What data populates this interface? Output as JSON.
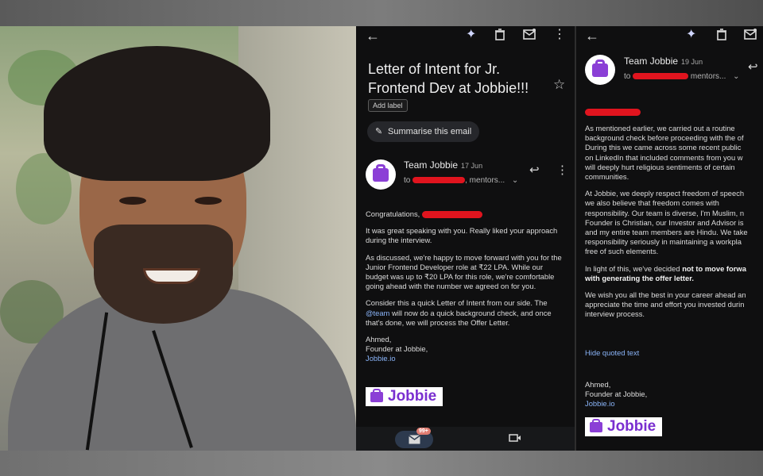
{
  "email1": {
    "subject": "Letter of Intent for Jr. Frontend Dev at Jobbie!!!",
    "label_chip": "Add label",
    "summarise_button": "Summarise this email",
    "sender": "Team Jobbie",
    "date": "17 Jun",
    "to_prefix": "to",
    "to_suffix": ", mentors...",
    "greeting": "Congratulations,",
    "paragraphs": [
      "It was great speaking with you. Really liked your approach during the interview.",
      "As discussed, we're happy to move forward with you for the Junior Frontend Developer role at ₹22 LPA. While our budget was up to ₹20 LPA for this role, we're comfortable going ahead with the number we agreed on for you."
    ],
    "para3_start": "Consider this a quick Letter of Intent from our side. The ",
    "para3_link": "@team",
    "para3_end": " will now do a quick background check, and once that's done, we will process the Offer Letter.",
    "signature_name": "Ahmed,",
    "signature_title": "Founder at Jobbie,",
    "signature_link": "Jobbie.io",
    "logo_text": "Jobbie",
    "unread_badge": "99+"
  },
  "email2": {
    "sender": "Team Jobbie",
    "date": "19 Jun",
    "to_prefix": "to",
    "to_suffix": "mentors...",
    "para1": [
      "As mentioned earlier, we carried out a routine",
      "background check before proceeding with the of",
      "During this we came across some recent public",
      "on LinkedIn that included comments from you w",
      "will deeply hurt religious sentiments of certain",
      "communities."
    ],
    "para2": [
      "At Jobbie, we deeply respect freedom of speech",
      "we also believe that freedom comes with",
      "responsibility. Our team is diverse, I'm Muslim, n",
      "Founder is Christian, our Investor and Advisor is",
      "and my entire team members are Hindu. We take",
      "responsibility seriously in maintaining a workpla",
      "free of such elements."
    ],
    "para3_start": "In light of this, we've decided ",
    "para3_bold_1": "not to move forwa",
    "para3_bold_2": "with generating the offer letter.",
    "para4": [
      "We wish you all the best in your career ahead an",
      "appreciate the time and effort you invested durin",
      "interview process."
    ],
    "hide_quoted": "Hide quoted text",
    "signature_name": "Ahmed,",
    "signature_title": "Founder at Jobbie,",
    "signature_link": "Jobbie.io",
    "logo_text": "Jobbie"
  },
  "icons": {
    "back": "arrow-left-icon",
    "sparkle": "sparkle-icon",
    "delete": "trash-icon",
    "mark_unread": "mail-icon",
    "more": "more-vert-icon",
    "star": "star-icon",
    "reply": "reply-icon",
    "chevron": "chevron-down-icon",
    "video": "video-icon"
  },
  "colors": {
    "background": "#0f0f10",
    "link": "#8ab4f8",
    "brand": "#8b3fd6",
    "redaction": "#e0141e"
  }
}
